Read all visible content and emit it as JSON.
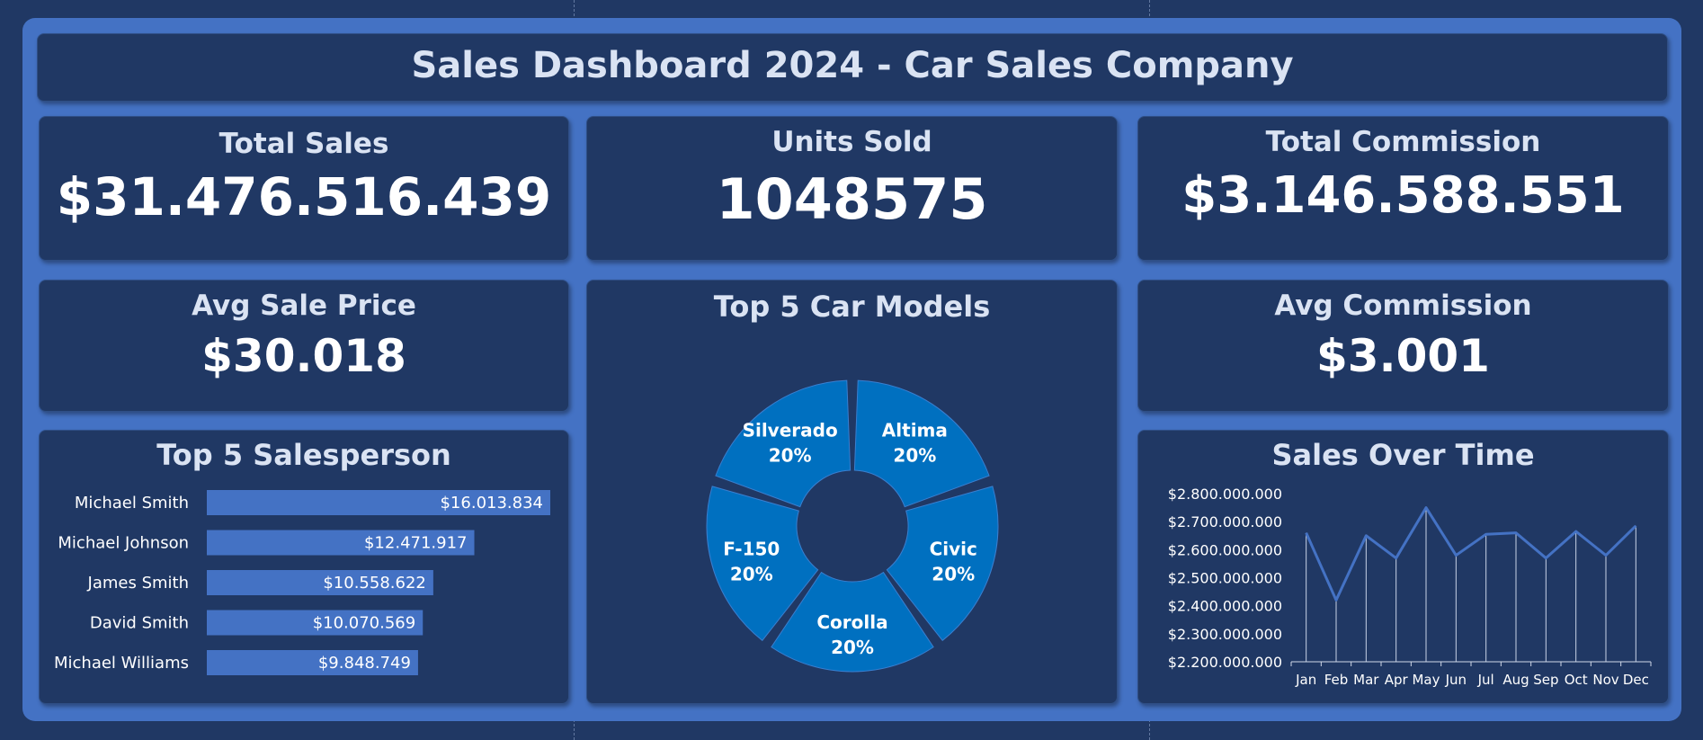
{
  "dashboard": {
    "title": "Sales Dashboard 2024 - Car Sales Company"
  },
  "kpis": {
    "total_sales": {
      "label": "Total Sales",
      "value": "$31.476.516.439"
    },
    "units_sold": {
      "label": "Units Sold",
      "value": "1048575"
    },
    "total_commission": {
      "label": "Total Commission",
      "value": "$3.146.588.551"
    },
    "avg_sale_price": {
      "label": "Avg Sale Price",
      "value": "$30.018"
    },
    "avg_commission": {
      "label": "Avg Commission",
      "value": "$3.001"
    }
  },
  "colors": {
    "background": "#203864",
    "frame": "#4472c4",
    "bar": "#4472c4",
    "donut": "#0070c0",
    "line": "#4472c4",
    "label_text": "#dae3f3"
  },
  "chart_data": [
    {
      "type": "bar",
      "orientation": "horizontal",
      "title": "Top 5 Salesperson",
      "categories": [
        "Michael Smith",
        "Michael Johnson",
        "James Smith",
        "David Smith",
        "Michael Williams"
      ],
      "values": [
        16013834,
        12471917,
        10558622,
        10070569,
        9848749
      ],
      "value_labels": [
        "$16.013.834",
        "$12.471.917",
        "$10.558.622",
        "$10.070.569",
        "$9.848.749"
      ],
      "xlim": [
        0,
        16013834
      ],
      "grid": false
    },
    {
      "type": "pie",
      "style": "donut",
      "title": "Top 5 Car Models",
      "slices": [
        {
          "label": "Altima",
          "percent_label": "20%",
          "value": 20
        },
        {
          "label": "Civic",
          "percent_label": "20%",
          "value": 20
        },
        {
          "label": "Corolla",
          "percent_label": "20%",
          "value": 20
        },
        {
          "label": "F-150",
          "percent_label": "20%",
          "value": 20
        },
        {
          "label": "Silverado",
          "percent_label": "20%",
          "value": 20
        }
      ]
    },
    {
      "type": "line",
      "title": "Sales Over Time",
      "categories": [
        "Jan",
        "Feb",
        "Mar",
        "Apr",
        "May",
        "Jun",
        "Jul",
        "Aug",
        "Sep",
        "Oct",
        "Nov",
        "Dec"
      ],
      "values": [
        2660000000,
        2420000000,
        2650000000,
        2570000000,
        2750000000,
        2580000000,
        2655000000,
        2660000000,
        2570000000,
        2665000000,
        2580000000,
        2685000000
      ],
      "ylim": [
        2200000000,
        2800000000
      ],
      "yticks": [
        2200000000,
        2300000000,
        2400000000,
        2500000000,
        2600000000,
        2700000000,
        2800000000
      ],
      "ytick_labels": [
        "$2.200.000.000",
        "$2.300.000.000",
        "$2.400.000.000",
        "$2.500.000.000",
        "$2.600.000.000",
        "$2.700.000.000",
        "$2.800.000.000"
      ],
      "drop_lines": true,
      "grid": false
    }
  ]
}
